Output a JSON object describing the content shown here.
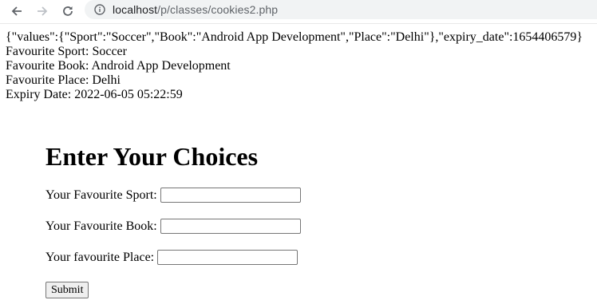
{
  "browser": {
    "url_host": "localhost",
    "url_path": "/p/classes/cookies2.php"
  },
  "output": {
    "json_line": "{\"values\":{\"Sport\":\"Soccer\",\"Book\":\"Android App Development\",\"Place\":\"Delhi\"},\"expiry_date\":1654406579}",
    "sport_line": "Favourite Sport: Soccer",
    "book_line": "Favourite Book: Android App Development",
    "place_line": "Favourite Place: Delhi",
    "expiry_line": "Expiry Date: 2022-06-05 05:22:59"
  },
  "form": {
    "heading": "Enter Your Choices",
    "sport_label": "Your Favourite Sport:",
    "sport_value": "",
    "book_label": "Your Favourite Book:",
    "book_value": "",
    "place_label": "Your favourite Place:",
    "place_value": "",
    "submit_label": "Submit"
  }
}
